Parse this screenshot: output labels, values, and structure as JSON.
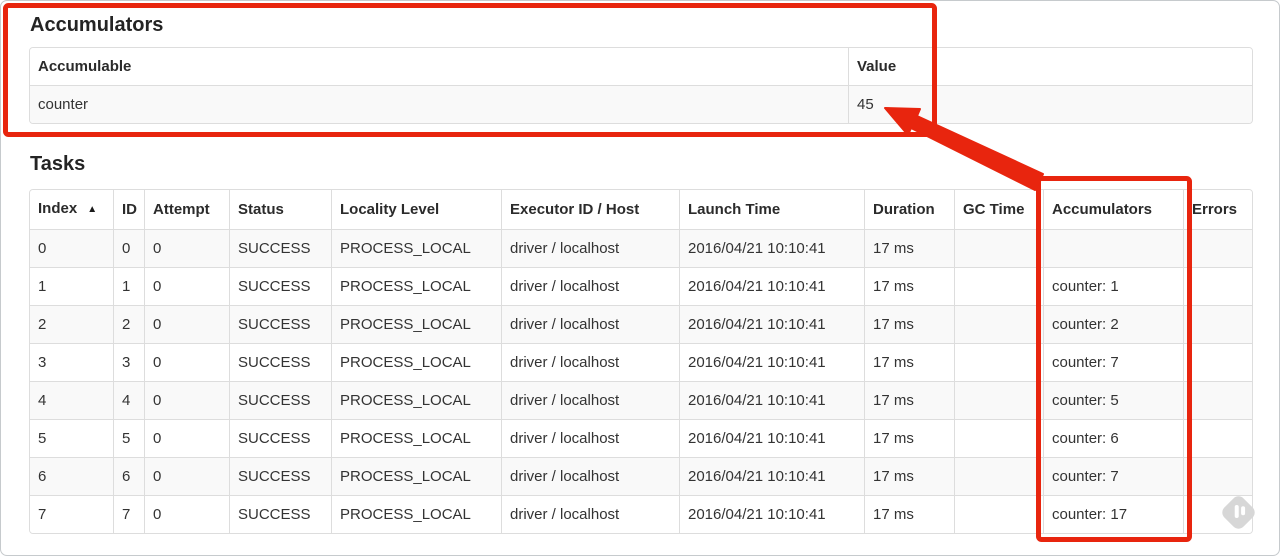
{
  "accumulators_section": {
    "title": "Accumulators",
    "table": {
      "headers": {
        "accumulable": "Accumulable",
        "value": "Value"
      },
      "row": {
        "name": "counter",
        "value": "45"
      }
    }
  },
  "tasks_section": {
    "title": "Tasks",
    "table": {
      "headers": [
        "Index",
        "ID",
        "Attempt",
        "Status",
        "Locality Level",
        "Executor ID / Host",
        "Launch Time",
        "Duration",
        "GC Time",
        "Accumulators",
        "Errors"
      ],
      "sort_icon": "▲",
      "rows": [
        [
          "0",
          "0",
          "0",
          "SUCCESS",
          "PROCESS_LOCAL",
          "driver / localhost",
          "2016/04/21 10:10:41",
          "17 ms",
          "",
          "",
          ""
        ],
        [
          "1",
          "1",
          "0",
          "SUCCESS",
          "PROCESS_LOCAL",
          "driver / localhost",
          "2016/04/21 10:10:41",
          "17 ms",
          "",
          "counter: 1",
          ""
        ],
        [
          "2",
          "2",
          "0",
          "SUCCESS",
          "PROCESS_LOCAL",
          "driver / localhost",
          "2016/04/21 10:10:41",
          "17 ms",
          "",
          "counter: 2",
          ""
        ],
        [
          "3",
          "3",
          "0",
          "SUCCESS",
          "PROCESS_LOCAL",
          "driver / localhost",
          "2016/04/21 10:10:41",
          "17 ms",
          "",
          "counter: 7",
          ""
        ],
        [
          "4",
          "4",
          "0",
          "SUCCESS",
          "PROCESS_LOCAL",
          "driver / localhost",
          "2016/04/21 10:10:41",
          "17 ms",
          "",
          "counter: 5",
          ""
        ],
        [
          "5",
          "5",
          "0",
          "SUCCESS",
          "PROCESS_LOCAL",
          "driver / localhost",
          "2016/04/21 10:10:41",
          "17 ms",
          "",
          "counter: 6",
          ""
        ],
        [
          "6",
          "6",
          "0",
          "SUCCESS",
          "PROCESS_LOCAL",
          "driver / localhost",
          "2016/04/21 10:10:41",
          "17 ms",
          "",
          "counter: 7",
          ""
        ],
        [
          "7",
          "7",
          "0",
          "SUCCESS",
          "PROCESS_LOCAL",
          "driver / localhost",
          "2016/04/21 10:10:41",
          "17 ms",
          "",
          "counter: 17",
          ""
        ]
      ]
    }
  },
  "annotations": {
    "color": "#e8250e",
    "box_accumulators_section": "highlight around Accumulators summary table",
    "box_accumulators_column": "highlight around Accumulators task column",
    "arrow": "arrow from Accumulators column to total value 45"
  },
  "colors": {
    "table_border": "#dddddd",
    "row_stripe": "#f9f9f9",
    "text": "#333333"
  }
}
